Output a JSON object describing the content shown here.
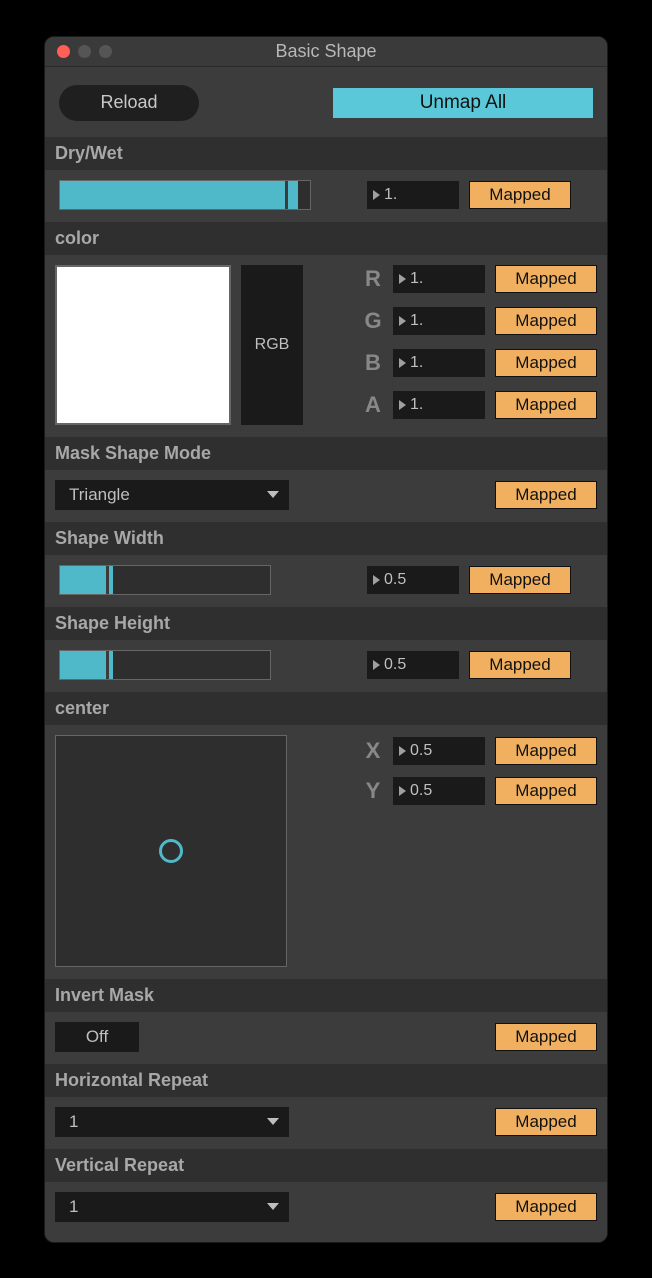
{
  "window": {
    "title": "Basic Shape"
  },
  "toolbar": {
    "reload_label": "Reload",
    "unmap_label": "Unmap All"
  },
  "mapped_label": "Mapped",
  "sections": {
    "drywet": {
      "header": "Dry/Wet",
      "value": "1.",
      "fill_pct": 95
    },
    "color": {
      "header": "color",
      "mode_label": "RGB",
      "channels": {
        "r_label": "R",
        "r_value": "1.",
        "g_label": "G",
        "g_value": "1.",
        "b_label": "B",
        "b_value": "1.",
        "a_label": "A",
        "a_value": "1."
      },
      "swatch_hex": "#ffffff"
    },
    "mask_mode": {
      "header": "Mask Shape Mode",
      "value": "Triangle"
    },
    "shape_width": {
      "header": "Shape Width",
      "value": "0.5",
      "fill_pct": 25
    },
    "shape_height": {
      "header": "Shape Height",
      "value": "0.5",
      "fill_pct": 25
    },
    "center": {
      "header": "center",
      "x_label": "X",
      "x_value": "0.5",
      "y_label": "Y",
      "y_value": "0.5"
    },
    "invert": {
      "header": "Invert Mask",
      "value": "Off"
    },
    "hrepeat": {
      "header": "Horizontal Repeat",
      "value": "1"
    },
    "vrepeat": {
      "header": "Vertical Repeat",
      "value": "1"
    }
  }
}
